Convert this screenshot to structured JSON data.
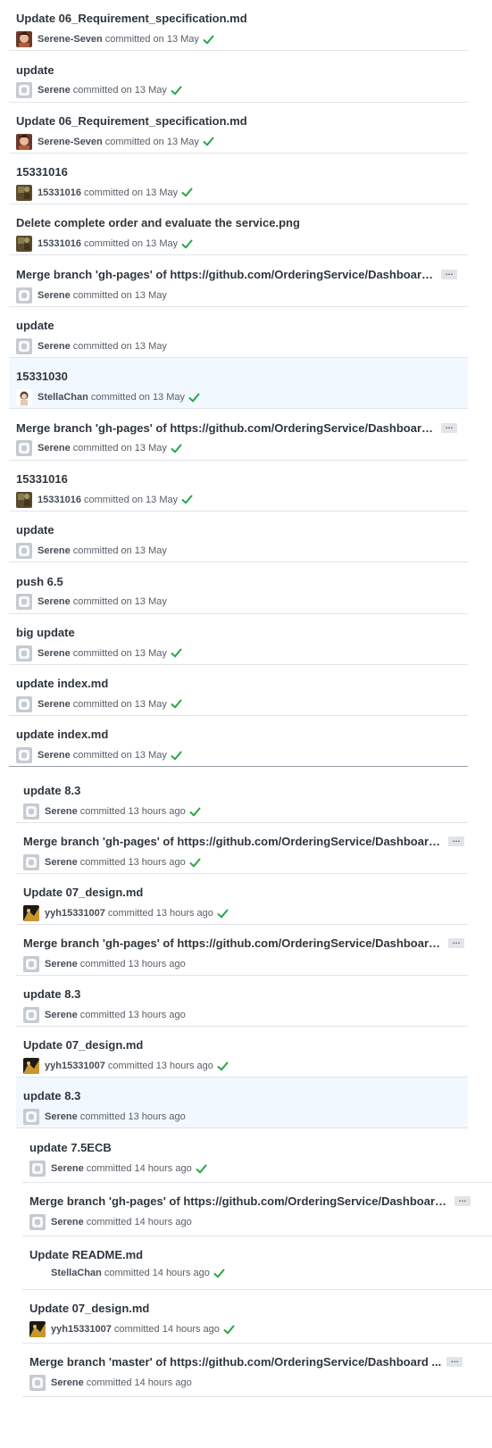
{
  "sections": [
    {
      "commits": [
        {
          "title": "Update 06_Requirement_specification.md",
          "author": "Serene-Seven",
          "avatar": "photo-avatar-serene-seven",
          "time": "committed on 13 May",
          "check": true,
          "ellipsis": false,
          "highlight": false
        },
        {
          "title": "update",
          "author": "Serene",
          "avatar": "default-avatar",
          "time": "committed on 13 May",
          "check": true,
          "ellipsis": false,
          "highlight": false
        },
        {
          "title": "Update 06_Requirement_specification.md",
          "author": "Serene-Seven",
          "avatar": "photo-avatar-serene-seven",
          "time": "committed on 13 May",
          "check": true,
          "ellipsis": false,
          "highlight": false
        },
        {
          "title": "15331016",
          "author": "15331016",
          "avatar": "photo-avatar-15331016",
          "time": "committed on 13 May",
          "check": true,
          "ellipsis": false,
          "highlight": false
        },
        {
          "title": "Delete complete order and evaluate the service.png",
          "author": "15331016",
          "avatar": "photo-avatar-15331016",
          "time": "committed on 13 May",
          "check": true,
          "ellipsis": false,
          "highlight": false
        },
        {
          "title": "Merge branch 'gh-pages' of https://github.com/OrderingService/Dashboard...",
          "author": "Serene",
          "avatar": "default-avatar",
          "time": "committed on 13 May",
          "check": false,
          "ellipsis": true,
          "highlight": false
        },
        {
          "title": "update",
          "author": "Serene",
          "avatar": "default-avatar",
          "time": "committed on 13 May",
          "check": false,
          "ellipsis": false,
          "highlight": false
        },
        {
          "title": "15331030",
          "author": "StellaChan",
          "avatar": "photo-avatar-stellachan",
          "time": "committed on 13 May",
          "check": true,
          "ellipsis": false,
          "highlight": true
        },
        {
          "title": "Merge branch 'gh-pages' of https://github.com/OrderingService/Dashboard...",
          "author": "Serene",
          "avatar": "default-avatar",
          "time": "committed on 13 May",
          "check": true,
          "ellipsis": true,
          "highlight": false
        },
        {
          "title": "15331016",
          "author": "15331016",
          "avatar": "photo-avatar-15331016",
          "time": "committed on 13 May",
          "check": true,
          "ellipsis": false,
          "highlight": false
        },
        {
          "title": "update",
          "author": "Serene",
          "avatar": "default-avatar",
          "time": "committed on 13 May",
          "check": false,
          "ellipsis": false,
          "highlight": false
        },
        {
          "title": "push 6.5",
          "author": "Serene",
          "avatar": "default-avatar",
          "time": "committed on 13 May",
          "check": false,
          "ellipsis": false,
          "highlight": false
        },
        {
          "title": "big update",
          "author": "Serene",
          "avatar": "default-avatar",
          "time": "committed on 13 May",
          "check": true,
          "ellipsis": false,
          "highlight": false
        },
        {
          "title": "update index.md",
          "author": "Serene",
          "avatar": "default-avatar",
          "time": "committed on 13 May",
          "check": true,
          "ellipsis": false,
          "highlight": false
        },
        {
          "title": "update index.md",
          "author": "Serene",
          "avatar": "default-avatar",
          "time": "committed on 13 May",
          "check": true,
          "ellipsis": false,
          "highlight": false
        }
      ]
    },
    {
      "commits": [
        {
          "title": "update 8.3",
          "author": "Serene",
          "avatar": "default-avatar",
          "time": "committed 13 hours ago",
          "check": true,
          "ellipsis": false,
          "highlight": false
        },
        {
          "title": "Merge branch 'gh-pages' of https://github.com/OrderingService/Dashboard...",
          "author": "Serene",
          "avatar": "default-avatar",
          "time": "committed 13 hours ago",
          "check": true,
          "ellipsis": true,
          "highlight": false
        },
        {
          "title": "Update 07_design.md",
          "author": "yyh15331007",
          "avatar": "photo-avatar-yyh15331007",
          "time": "committed 13 hours ago",
          "check": true,
          "ellipsis": false,
          "highlight": false
        },
        {
          "title": "Merge branch 'gh-pages' of https://github.com/OrderingService/Dashboard...",
          "author": "Serene",
          "avatar": "default-avatar",
          "time": "committed 13 hours ago",
          "check": false,
          "ellipsis": true,
          "highlight": false
        },
        {
          "title": "update 8.3",
          "author": "Serene",
          "avatar": "default-avatar",
          "time": "committed 13 hours ago",
          "check": false,
          "ellipsis": false,
          "highlight": false
        },
        {
          "title": "Update 07_design.md",
          "author": "yyh15331007",
          "avatar": "photo-avatar-yyh15331007",
          "time": "committed 13 hours ago",
          "check": true,
          "ellipsis": false,
          "highlight": false
        },
        {
          "title": "update 8.3",
          "author": "Serene",
          "avatar": "default-avatar",
          "time": "committed 13 hours ago",
          "check": false,
          "ellipsis": false,
          "highlight": true
        }
      ]
    },
    {
      "commits": [
        {
          "title": "update 7.5ECB",
          "author": "Serene",
          "avatar": "default-avatar",
          "time": "committed 14 hours ago",
          "check": true,
          "ellipsis": false,
          "highlight": false
        },
        {
          "title": "Merge branch 'gh-pages' of https://github.com/OrderingService/Dashboard...",
          "author": "Serene",
          "avatar": "default-avatar",
          "time": "committed 14 hours ago",
          "check": false,
          "ellipsis": true,
          "highlight": false
        },
        {
          "title": "Update README.md",
          "author": "StellaChan",
          "avatar": "none",
          "time": "committed 14 hours ago",
          "check": true,
          "ellipsis": false,
          "highlight": false
        },
        {
          "title": "Update 07_design.md",
          "author": "yyh15331007",
          "avatar": "photo-avatar-yyh15331007",
          "time": "committed 14 hours ago",
          "check": true,
          "ellipsis": false,
          "highlight": false
        },
        {
          "title": "Merge branch 'master' of https://github.com/OrderingService/Dashboard ...",
          "author": "Serene",
          "avatar": "default-avatar",
          "time": "committed 14 hours ago",
          "check": false,
          "ellipsis": true,
          "highlight": false
        }
      ]
    }
  ],
  "ui": {
    "ellipsis_label": "…",
    "check_color": "#28a745",
    "highlight_color": "#f1f8ff"
  }
}
